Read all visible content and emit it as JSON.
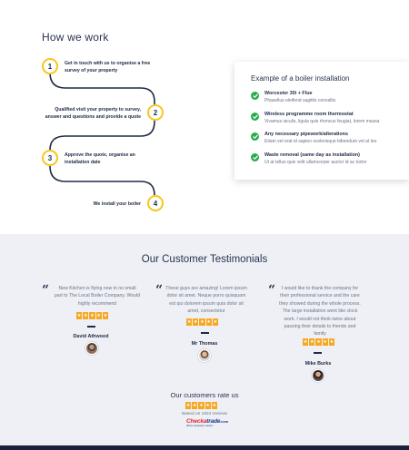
{
  "how_we_work": {
    "title": "How we work",
    "steps": [
      {
        "number": "1",
        "text_line1": "Get in touch with us to organise a free",
        "text_line2": "survey of your property"
      },
      {
        "number": "2",
        "text_line1": "Qualified visit your property to survey,",
        "text_line2": "answer and questions and provide a quote"
      },
      {
        "number": "3",
        "text_line1": "Approve the quote, organise an",
        "text_line2": "installation date"
      },
      {
        "number": "4",
        "text_line1": "We install your boiler",
        "text_line2": ""
      }
    ],
    "accent_color": "#f3c81d"
  },
  "boiler_example": {
    "title": "Example of a boiler installation",
    "items": [
      {
        "title": "Worcester 30i + Flue",
        "description": "Phasellus eleifend sagittis convallis"
      },
      {
        "title": "Wireless programme room thermostat",
        "description": "Vivamus iaculis, ligula quis rhoncus feugiat, lorem massa"
      },
      {
        "title": "Any necessary pipework/alterations",
        "description": "Etiam vel erat id sapien scelerisque bibendum vel at leo"
      },
      {
        "title": "Waste removal (same day as installation)",
        "description": "Ut at tellus quis velit ullamcorper auctor id ac tortor"
      }
    ],
    "check_icon": "check-circle-icon",
    "check_color": "#27ae4d"
  },
  "testimonials": {
    "title": "Our Customer Testimonials",
    "items": [
      {
        "line1": "New Kitchen is flying now in no small",
        "line2": "part to The Local Boiler Company. Would",
        "line3": "highly recommend",
        "author": "David Athwood"
      },
      {
        "line1": "These guys are amazing! Lorem ipsum",
        "line2": "dolor sit amet. Neque porro quisquam",
        "line3": "est qui dolorem ipsum quia dolor sit",
        "line4": "amet, consectetur",
        "author": "Mr Thomas"
      },
      {
        "line1": "I would like to thank the company for",
        "line2": "their professional service and the care",
        "line3": "they showed during the whole process.",
        "line4": "The large installation went like clock",
        "line5": "work. I would not think twice about",
        "line6": "passing their details to friends and",
        "line7": "family",
        "author": "Mike Burks"
      }
    ],
    "star_color": "#f7a823"
  },
  "rating": {
    "title": "Our customers rate us",
    "reviews": "Based on 1924 reviews",
    "brand_prefix": "Checka",
    "brand_suffix": "trade",
    "brand_dotcom": ".com",
    "brand_tagline": "Where reputation matters"
  }
}
